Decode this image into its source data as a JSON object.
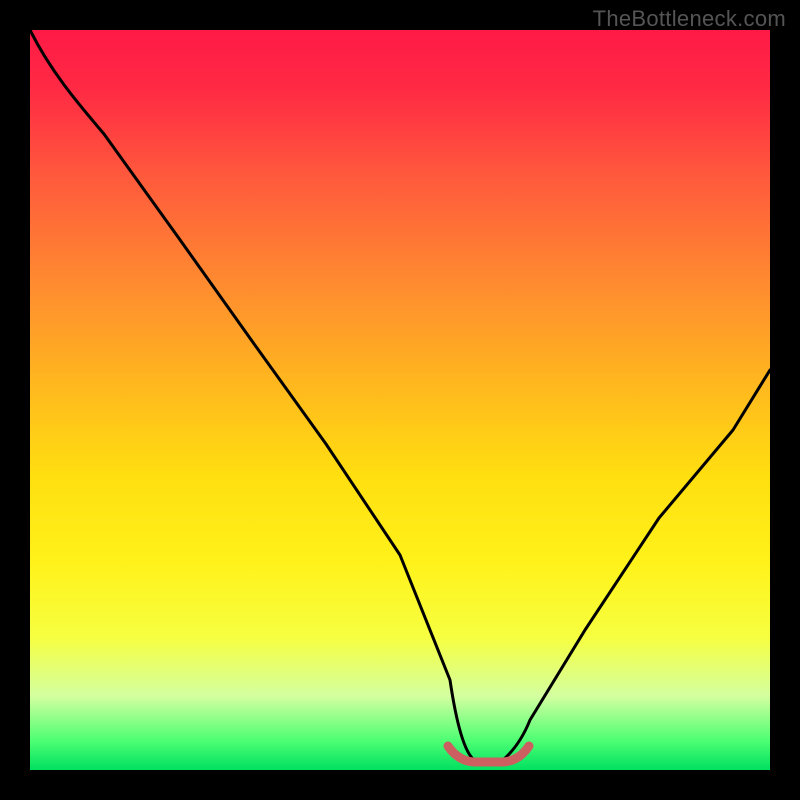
{
  "watermark": "TheBottleneck.com",
  "chart_data": {
    "type": "line",
    "title": "",
    "xlabel": "",
    "ylabel": "",
    "xlim": [
      0,
      100
    ],
    "ylim": [
      0,
      100
    ],
    "grid": false,
    "legend": false,
    "background_gradient": {
      "top": "#ff1a46",
      "mid": "#ffde10",
      "bottom": "#00e060"
    },
    "series": [
      {
        "name": "bottleneck-curve",
        "color": "#000000",
        "x": [
          0,
          5,
          10,
          15,
          20,
          25,
          30,
          35,
          40,
          45,
          50,
          55,
          56,
          60,
          64,
          65,
          70,
          75,
          80,
          85,
          90,
          95,
          100
        ],
        "values": [
          100,
          94,
          86,
          78,
          70,
          61,
          52,
          44,
          35,
          26,
          17,
          8,
          3,
          1,
          1,
          3,
          10,
          18,
          26,
          34,
          42,
          50,
          58
        ]
      },
      {
        "name": "optimal-marker",
        "color": "#d05a5a",
        "type": "segment",
        "x": [
          55,
          57,
          63,
          65
        ],
        "values": [
          3,
          1,
          1,
          3
        ]
      }
    ],
    "optimal_range_x": [
      56,
      64
    ],
    "notes": "V-shaped curve on vertical red→yellow→green gradient; minimum near x≈60. Short salmon segment marks the trough. Axes unlabeled; values estimated as percent of frame height from bottom."
  }
}
